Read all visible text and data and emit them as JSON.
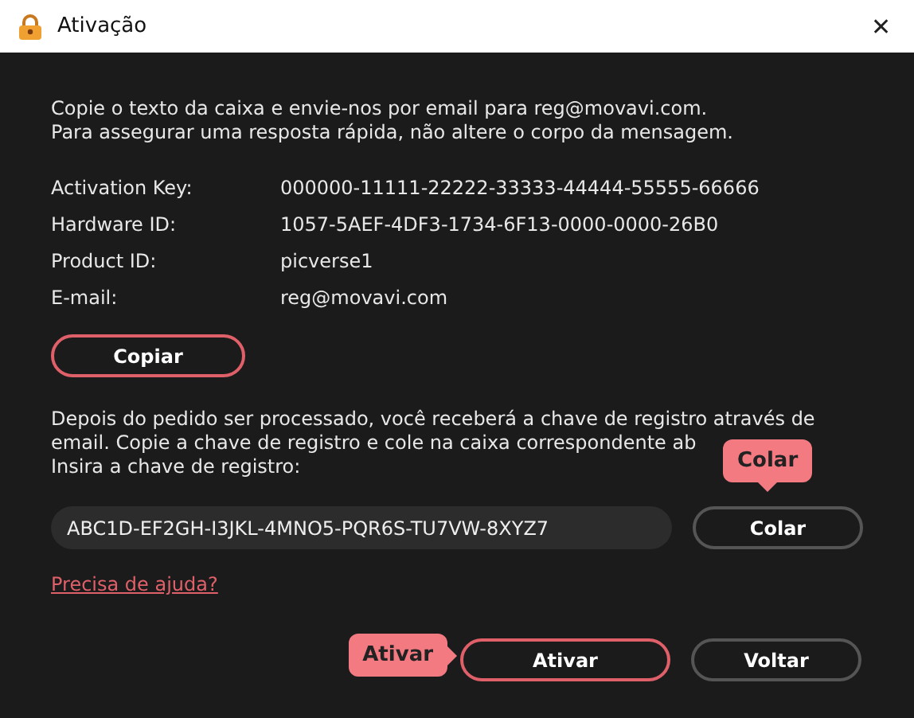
{
  "window": {
    "title": "Ativação",
    "close": "✕"
  },
  "intro": [
    "Copie o texto da caixa e envie-nos por email para reg@movavi.com.",
    "Para assegurar uma resposta rápida, não altere o corpo da mensagem."
  ],
  "info": [
    {
      "label": "Activation Key:",
      "value": "000000-11111-22222-33333-44444-55555-66666"
    },
    {
      "label": "Hardware ID:",
      "value": "1057-5AEF-4DF3-1734-6F13-0000-0000-26B0"
    },
    {
      "label": "Product ID:",
      "value": "picverse1"
    },
    {
      "label": "E-mail:",
      "value": "reg@movavi.com"
    }
  ],
  "copy_button": "Copiar",
  "instructions": [
    "Depois do pedido ser processado, você receberá a chave de registro através de",
    "email. Copie a chave de registro e cole na caixa correspondente ab"
  ],
  "key_label": "Insira a chave de registro:",
  "key_field": {
    "value": "ABC1D-EF2GH-I3JKL-4MNO5-PQR6S-TU7VW-8XYZ7"
  },
  "paste_button": {
    "label": "Colar",
    "callout": "Colar"
  },
  "help_link": "Precisa de ajuda?",
  "buttons": [
    {
      "label": "Ativar",
      "primary": true,
      "callout": "Ativar"
    },
    {
      "label": "Voltar",
      "primary": false
    }
  ]
}
